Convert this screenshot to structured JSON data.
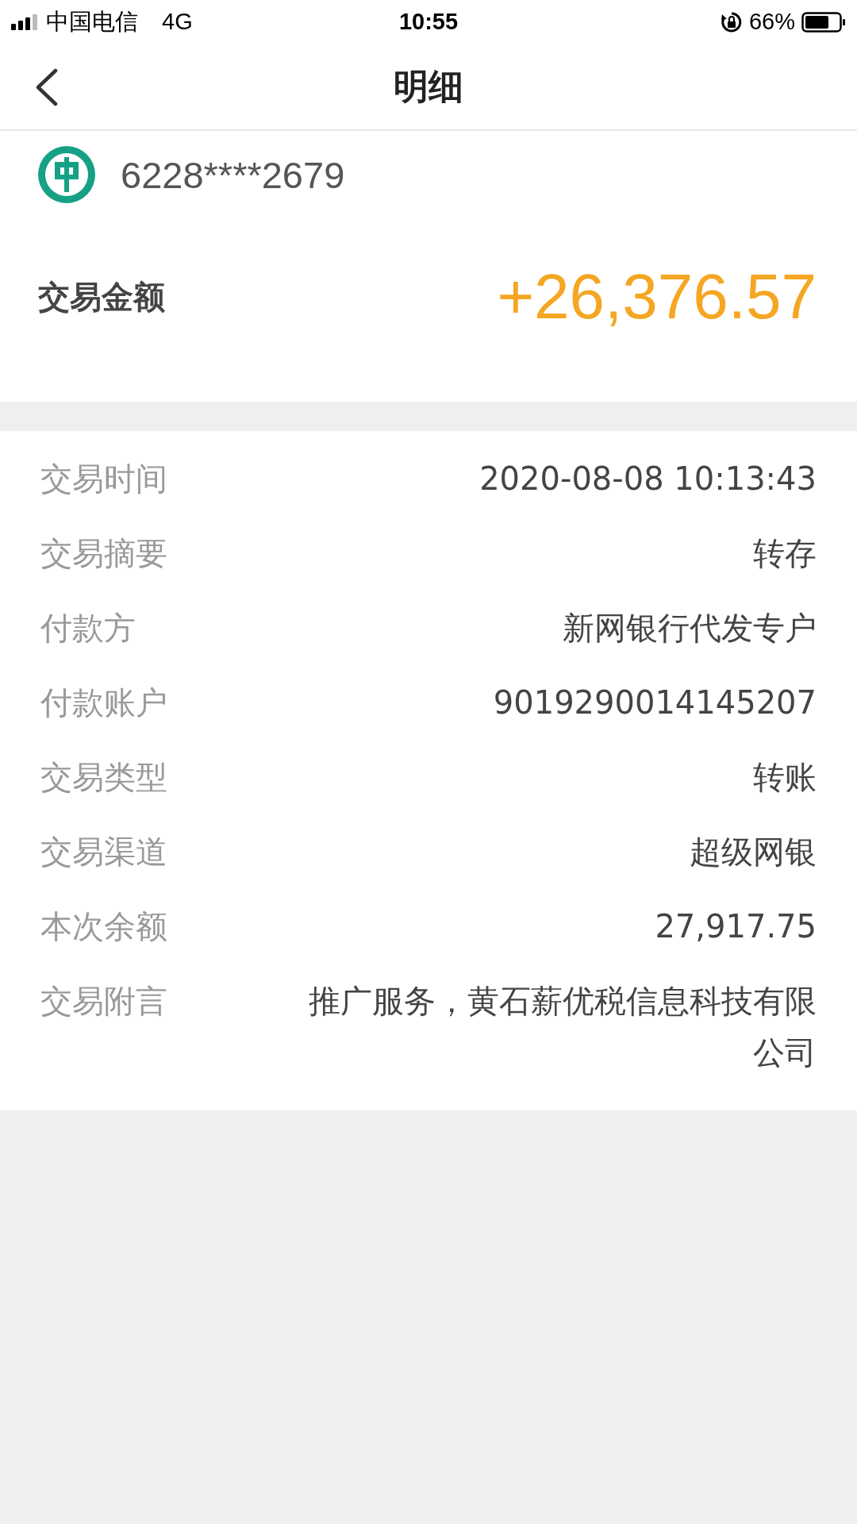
{
  "status_bar": {
    "carrier": "中国电信",
    "network": "4G",
    "time": "10:55",
    "battery": "66%"
  },
  "nav": {
    "title": "明细"
  },
  "account": {
    "number": "6228****2679"
  },
  "amount": {
    "label": "交易金额",
    "value": "+26,376.57"
  },
  "details": [
    {
      "label": "交易时间",
      "value": "2020-08-08 10:13:43"
    },
    {
      "label": "交易摘要",
      "value": "转存"
    },
    {
      "label": "付款方",
      "value": "新网银行代发专户"
    },
    {
      "label": "付款账户",
      "value": "9019290014145207"
    },
    {
      "label": "交易类型",
      "value": "转账"
    },
    {
      "label": "交易渠道",
      "value": "超级网银"
    },
    {
      "label": "本次余额",
      "value": "27,917.75"
    },
    {
      "label": "交易附言",
      "value": "推广服务，黄石薪优税信息科技有限公司"
    }
  ]
}
